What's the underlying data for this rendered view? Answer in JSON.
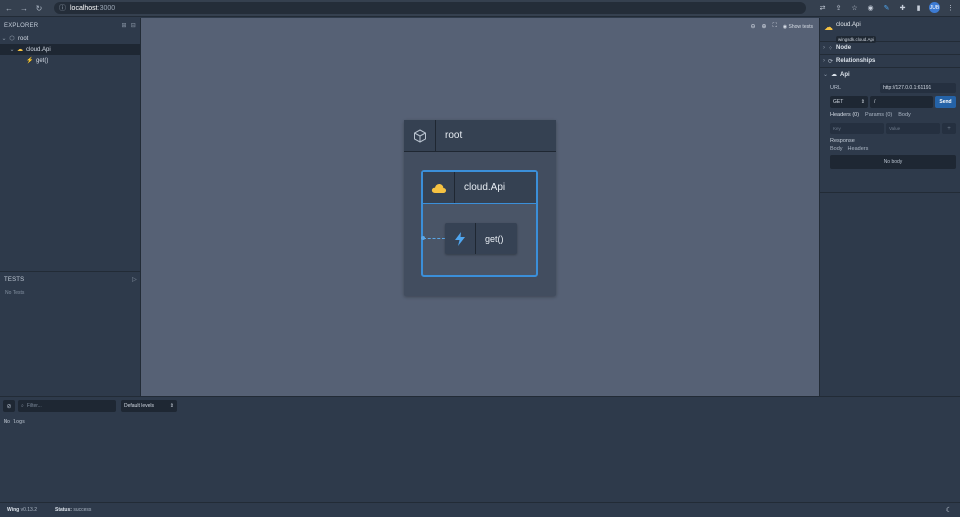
{
  "browser": {
    "url_host": "localhost",
    "url_port": ":3000",
    "avatar": "JUB"
  },
  "explorer": {
    "title": "EXPLORER",
    "items": [
      {
        "label": "root"
      },
      {
        "label": "cloud.Api"
      },
      {
        "label": "get()"
      }
    ]
  },
  "tests": {
    "title": "TESTS",
    "empty": "No Tests"
  },
  "canvas": {
    "show_tests": "Show tests",
    "root_title": "root",
    "api_title": "cloud.Api",
    "get_title": "get()"
  },
  "inspector": {
    "name": "cloud.Api",
    "type": "wingsdk.cloud.Api",
    "sections": {
      "node": "Node",
      "relationships": "Relationships",
      "api": "Api"
    },
    "url_label": "URL",
    "url_value": "http://127.0.0.1:61191",
    "method": "GET",
    "path": "/",
    "send": "Send",
    "tabs": [
      "Headers (0)",
      "Params (0)",
      "Body"
    ],
    "key_placeholder": "Key",
    "value_placeholder": "Value",
    "response_label": "Response",
    "response_tabs": [
      "Body",
      "Headers"
    ],
    "no_body": "No body"
  },
  "logs": {
    "filter_placeholder": "Filter...",
    "levels": "Default levels",
    "empty": "No logs"
  },
  "status": {
    "app": "Wing",
    "version": "v0.13.2",
    "status_label": "Status:",
    "status_value": "success"
  },
  "colors": {
    "accent": "#3b8fd9",
    "cloud": "#f5c242",
    "bolt": "#4fa6f0"
  }
}
